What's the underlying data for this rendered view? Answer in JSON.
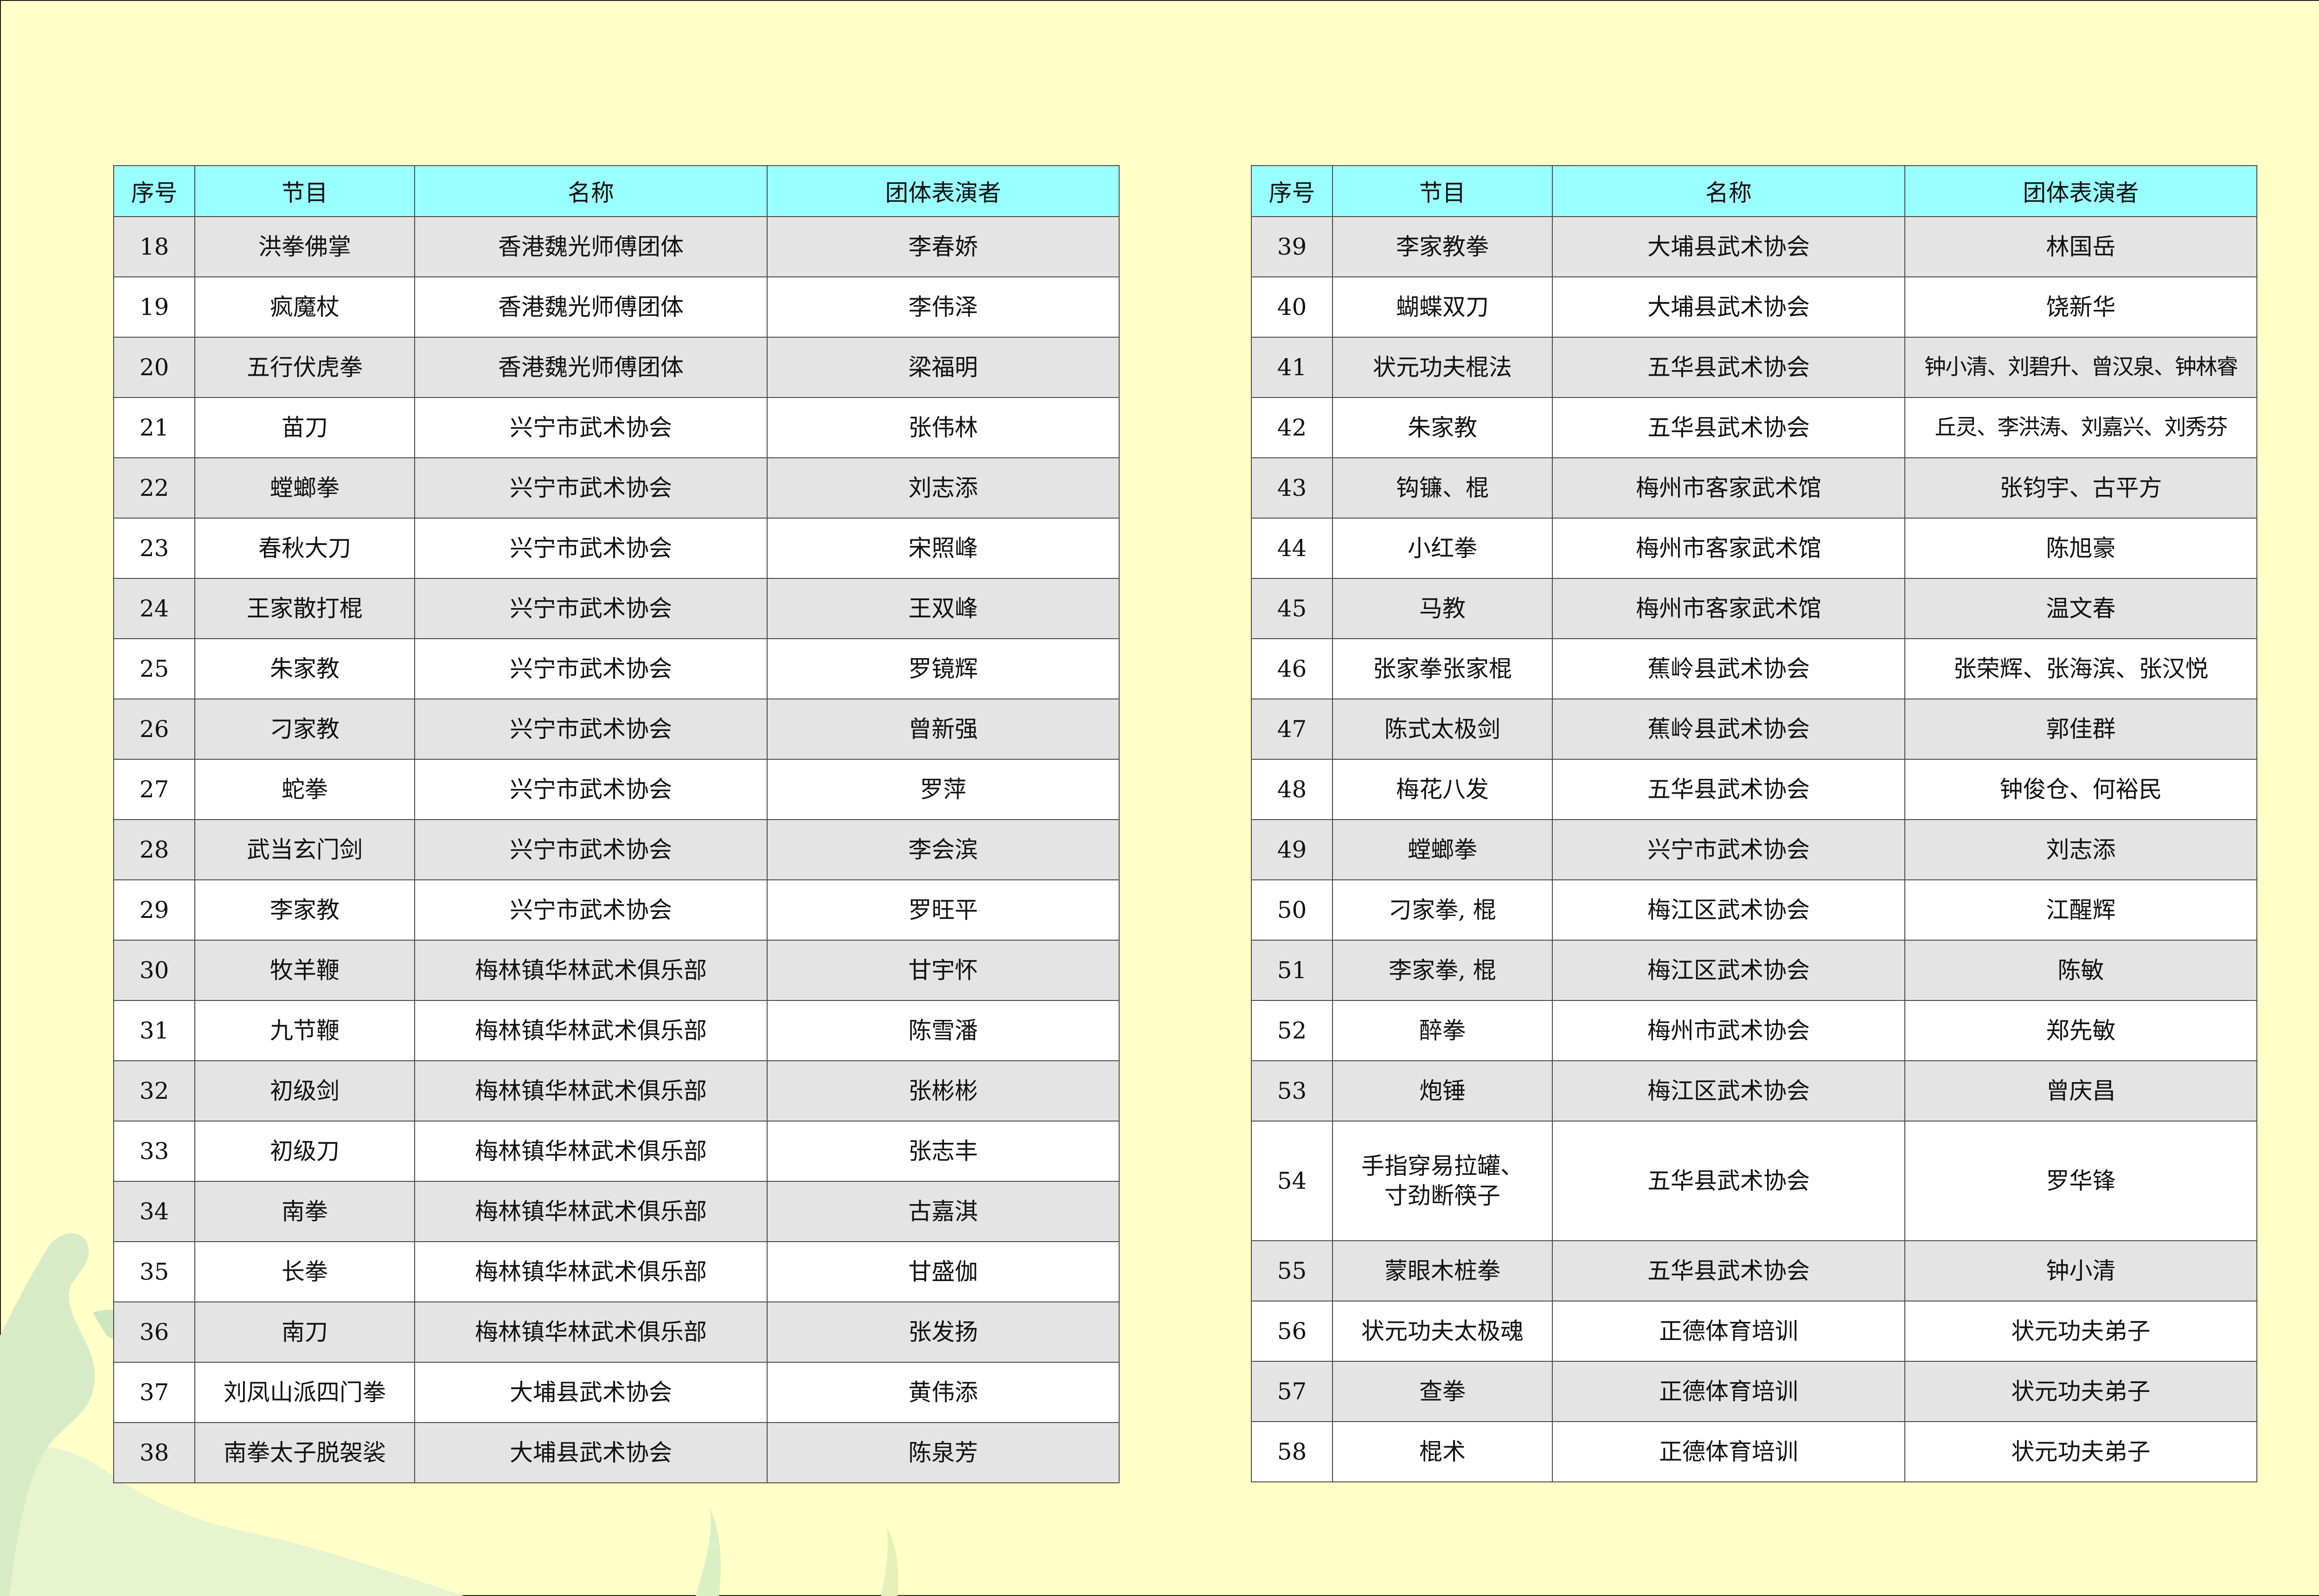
{
  "table": {
    "headers": [
      "序号",
      "节目",
      "名称",
      "团体表演者"
    ],
    "left_rows": [
      {
        "no": "18",
        "item": "洪拳佛掌",
        "org": "香港魏光师傅团体",
        "performer": "李春娇"
      },
      {
        "no": "19",
        "item": "疯魔杖",
        "org": "香港魏光师傅团体",
        "performer": "李伟泽"
      },
      {
        "no": "20",
        "item": "五行伏虎拳",
        "org": "香港魏光师傅团体",
        "performer": "梁福明"
      },
      {
        "no": "21",
        "item": "苗刀",
        "org": "兴宁市武术协会",
        "performer": "张伟林"
      },
      {
        "no": "22",
        "item": "螳螂拳",
        "org": "兴宁市武术协会",
        "performer": "刘志添"
      },
      {
        "no": "23",
        "item": "春秋大刀",
        "org": "兴宁市武术协会",
        "performer": "宋照峰"
      },
      {
        "no": "24",
        "item": "王家散打棍",
        "org": "兴宁市武术协会",
        "performer": "王双峰"
      },
      {
        "no": "25",
        "item": "朱家教",
        "org": "兴宁市武术协会",
        "performer": "罗镜辉"
      },
      {
        "no": "26",
        "item": "刁家教",
        "org": "兴宁市武术协会",
        "performer": "曾新强"
      },
      {
        "no": "27",
        "item": "蛇拳",
        "org": "兴宁市武术协会",
        "performer": "罗萍"
      },
      {
        "no": "28",
        "item": "武当玄门剑",
        "org": "兴宁市武术协会",
        "performer": "李会滨"
      },
      {
        "no": "29",
        "item": "李家教",
        "org": "兴宁市武术协会",
        "performer": "罗旺平"
      },
      {
        "no": "30",
        "item": "牧羊鞭",
        "org": "梅林镇华林武术俱乐部",
        "performer": "甘宇怀"
      },
      {
        "no": "31",
        "item": "九节鞭",
        "org": "梅林镇华林武术俱乐部",
        "performer": "陈雪潘"
      },
      {
        "no": "32",
        "item": "初级剑",
        "org": "梅林镇华林武术俱乐部",
        "performer": "张彬彬"
      },
      {
        "no": "33",
        "item": "初级刀",
        "org": "梅林镇华林武术俱乐部",
        "performer": "张志丰"
      },
      {
        "no": "34",
        "item": "南拳",
        "org": "梅林镇华林武术俱乐部",
        "performer": "古嘉淇"
      },
      {
        "no": "35",
        "item": "长拳",
        "org": "梅林镇华林武术俱乐部",
        "performer": "甘盛伽"
      },
      {
        "no": "36",
        "item": "南刀",
        "org": "梅林镇华林武术俱乐部",
        "performer": "张发扬"
      },
      {
        "no": "37",
        "item": "刘凤山派四门拳",
        "org": "大埔县武术协会",
        "performer": "黄伟添"
      },
      {
        "no": "38",
        "item": "南拳太子脱袈裟",
        "org": "大埔县武术协会",
        "performer": "陈泉芳"
      }
    ],
    "right_rows": [
      {
        "no": "39",
        "item": "李家教拳",
        "org": "大埔县武术协会",
        "performer": "林国岳"
      },
      {
        "no": "40",
        "item": "蝴蝶双刀",
        "org": "大埔县武术协会",
        "performer": "饶新华"
      },
      {
        "no": "41",
        "item": "状元功夫棍法",
        "org": "五华县武术协会",
        "performer": "钟小清、刘碧升、曾汉泉、钟林睿"
      },
      {
        "no": "42",
        "item": "朱家教",
        "org": "五华县武术协会",
        "performer": "丘灵、李洪涛、刘嘉兴、刘秀芬"
      },
      {
        "no": "43",
        "item": "钩镰、棍",
        "org": "梅州市客家武术馆",
        "performer": "张钧宇、古平方"
      },
      {
        "no": "44",
        "item": "小红拳",
        "org": "梅州市客家武术馆",
        "performer": "陈旭豪"
      },
      {
        "no": "45",
        "item": "马教",
        "org": "梅州市客家武术馆",
        "performer": "温文春"
      },
      {
        "no": "46",
        "item": "张家拳张家棍",
        "org": "蕉岭县武术协会",
        "performer": "张荣辉、张海滨、张汉悦"
      },
      {
        "no": "47",
        "item": "陈式太极剑",
        "org": "蕉岭县武术协会",
        "performer": "郭佳群"
      },
      {
        "no": "48",
        "item": "梅花八发",
        "org": "五华县武术协会",
        "performer": "钟俊仓、何裕民"
      },
      {
        "no": "49",
        "item": "螳螂拳",
        "org": "兴宁市武术协会",
        "performer": "刘志添"
      },
      {
        "no": "50",
        "item": "刁家拳, 棍",
        "org": "梅江区武术协会",
        "performer": "江醒辉"
      },
      {
        "no": "51",
        "item": "李家拳, 棍",
        "org": "梅江区武术协会",
        "performer": "陈敏"
      },
      {
        "no": "52",
        "item": "醉拳",
        "org": "梅州市武术协会",
        "performer": "郑先敏"
      },
      {
        "no": "53",
        "item": "炮锤",
        "org": "梅江区武术协会",
        "performer": "曾庆昌"
      },
      {
        "no": "54",
        "item": "手指穿易拉罐、寸劲断筷子",
        "org": "五华县武术协会",
        "performer": "罗华锋"
      },
      {
        "no": "55",
        "item": "蒙眼木桩拳",
        "org": "五华县武术协会",
        "performer": "钟小清"
      },
      {
        "no": "56",
        "item": "状元功夫太极魂",
        "org": "正德体育培训",
        "performer": "状元功夫弟子"
      },
      {
        "no": "57",
        "item": "查拳",
        "org": "正德体育培训",
        "performer": "状元功夫弟子"
      },
      {
        "no": "58",
        "item": "棍术",
        "org": "正德体育培训",
        "performer": "状元功夫弟子"
      }
    ]
  },
  "colors": {
    "page_background": "#ffffc7",
    "header_background": "#99ffff",
    "row_shaded": "#e4e4e4",
    "row_plain": "#ffffff",
    "border": "#4a4a4a"
  }
}
